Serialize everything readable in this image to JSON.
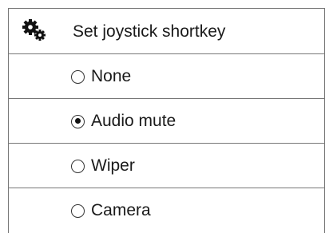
{
  "header": {
    "icon": "gears-icon",
    "title": "Set joystick shortkey"
  },
  "options": [
    {
      "label": "None",
      "checked": false
    },
    {
      "label": "Audio mute",
      "checked": true
    },
    {
      "label": "Wiper",
      "checked": false
    },
    {
      "label": "Camera",
      "checked": false
    }
  ]
}
